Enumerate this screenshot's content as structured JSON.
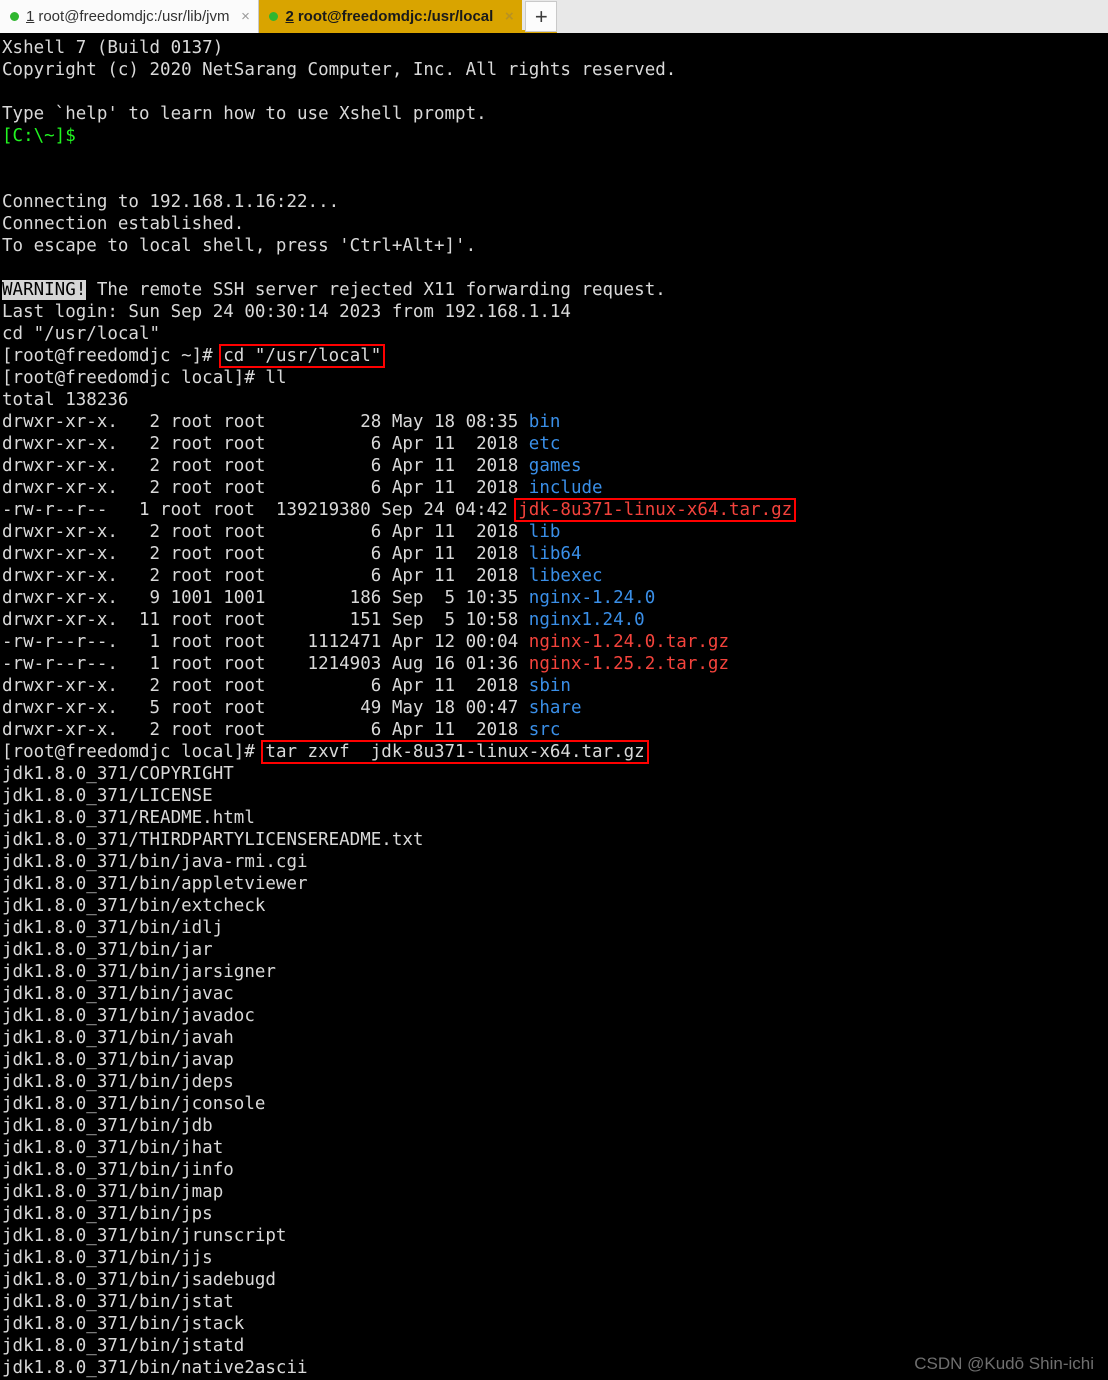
{
  "window": {
    "tabs": [
      {
        "index": "1",
        "title": "root@freedomdjc:/usr/lib/jvm",
        "close": "×",
        "active": false
      },
      {
        "index": "2",
        "title": "root@freedomdjc:/usr/local",
        "close": "×",
        "active": true
      }
    ],
    "new_tab_label": "+",
    "colors": {
      "active_tab_bg": "#d9a400",
      "inactive_tab_bg": "#fbfbfb",
      "tab_dot": "#2fb62f",
      "terminal_bg": "#000000",
      "terminal_fg": "#d6d6d6",
      "prompt_green": "#21f521",
      "dir_blue": "#3a8fe8",
      "archive_red": "#f4433c",
      "annotation_red": "#ff0000"
    }
  },
  "terminal": {
    "banner": {
      "product": "Xshell 7 (Build 0137)",
      "copyright": "Copyright (c) 2020 NetSarang Computer, Inc. All rights reserved.",
      "help_hint": "Type `help' to learn how to use Xshell prompt.",
      "local_prompt": "[C:\\~]$"
    },
    "session": {
      "connecting": "Connecting to 192.168.1.16:22...",
      "established": "Connection established.",
      "escape_hint": "To escape to local shell, press 'Ctrl+Alt+]'.",
      "warning_badge": "WARNING!",
      "warning_text": " The remote SSH server rejected X11 forwarding request.",
      "last_login": "Last login: Sun Sep 24 00:30:14 2023 from 192.168.1.14",
      "echoed_cd": "cd \"/usr/local\""
    },
    "cmd_cd": {
      "prompt": "[root@freedomdjc ~]# ",
      "command": "cd \"/usr/local\""
    },
    "cmd_ll": {
      "prompt": "[root@freedomdjc local]# ",
      "command": "ll",
      "total": "total 138236"
    },
    "listing": [
      {
        "perms": "drwxr-xr-x.",
        "links": "  2",
        "owner": "root",
        "group": "root",
        "size": "        28",
        "date": "May 18 08:35",
        "name": "bin",
        "type": "dir"
      },
      {
        "perms": "drwxr-xr-x.",
        "links": "  2",
        "owner": "root",
        "group": "root",
        "size": "         6",
        "date": "Apr 11  2018",
        "name": "etc",
        "type": "dir"
      },
      {
        "perms": "drwxr-xr-x.",
        "links": "  2",
        "owner": "root",
        "group": "root",
        "size": "         6",
        "date": "Apr 11  2018",
        "name": "games",
        "type": "dir"
      },
      {
        "perms": "drwxr-xr-x.",
        "links": "  2",
        "owner": "root",
        "group": "root",
        "size": "         6",
        "date": "Apr 11  2018",
        "name": "include",
        "type": "dir"
      },
      {
        "perms": "-rw-r--r--",
        "links": "  1",
        "owner": "root",
        "group": "root",
        "size": " 139219380",
        "date": "Sep 24 04:42",
        "name": "jdk-8u371-linux-x64.tar.gz",
        "type": "archive",
        "boxed": true
      },
      {
        "perms": "drwxr-xr-x.",
        "links": "  2",
        "owner": "root",
        "group": "root",
        "size": "         6",
        "date": "Apr 11  2018",
        "name": "lib",
        "type": "dir"
      },
      {
        "perms": "drwxr-xr-x.",
        "links": "  2",
        "owner": "root",
        "group": "root",
        "size": "         6",
        "date": "Apr 11  2018",
        "name": "lib64",
        "type": "dir"
      },
      {
        "perms": "drwxr-xr-x.",
        "links": "  2",
        "owner": "root",
        "group": "root",
        "size": "         6",
        "date": "Apr 11  2018",
        "name": "libexec",
        "type": "dir"
      },
      {
        "perms": "drwxr-xr-x.",
        "links": "  9",
        "owner": "1001",
        "group": "1001",
        "size": "       186",
        "date": "Sep  5 10:35",
        "name": "nginx-1.24.0",
        "type": "dir"
      },
      {
        "perms": "drwxr-xr-x.",
        "links": " 11",
        "owner": "root",
        "group": "root",
        "size": "       151",
        "date": "Sep  5 10:58",
        "name": "nginx1.24.0",
        "type": "dir"
      },
      {
        "perms": "-rw-r--r--.",
        "links": "  1",
        "owner": "root",
        "group": "root",
        "size": "   1112471",
        "date": "Apr 12 00:04",
        "name": "nginx-1.24.0.tar.gz",
        "type": "archive"
      },
      {
        "perms": "-rw-r--r--.",
        "links": "  1",
        "owner": "root",
        "group": "root",
        "size": "   1214903",
        "date": "Aug 16 01:36",
        "name": "nginx-1.25.2.tar.gz",
        "type": "archive"
      },
      {
        "perms": "drwxr-xr-x.",
        "links": "  2",
        "owner": "root",
        "group": "root",
        "size": "         6",
        "date": "Apr 11  2018",
        "name": "sbin",
        "type": "dir"
      },
      {
        "perms": "drwxr-xr-x.",
        "links": "  5",
        "owner": "root",
        "group": "root",
        "size": "        49",
        "date": "May 18 00:47",
        "name": "share",
        "type": "dir"
      },
      {
        "perms": "drwxr-xr-x.",
        "links": "  2",
        "owner": "root",
        "group": "root",
        "size": "         6",
        "date": "Apr 11  2018",
        "name": "src",
        "type": "dir"
      }
    ],
    "cmd_tar": {
      "prompt": "[root@freedomdjc local]# ",
      "command": "tar zxvf  jdk-8u371-linux-x64.tar.gz"
    },
    "tar_output": [
      "jdk1.8.0_371/COPYRIGHT",
      "jdk1.8.0_371/LICENSE",
      "jdk1.8.0_371/README.html",
      "jdk1.8.0_371/THIRDPARTYLICENSEREADME.txt",
      "jdk1.8.0_371/bin/java-rmi.cgi",
      "jdk1.8.0_371/bin/appletviewer",
      "jdk1.8.0_371/bin/extcheck",
      "jdk1.8.0_371/bin/idlj",
      "jdk1.8.0_371/bin/jar",
      "jdk1.8.0_371/bin/jarsigner",
      "jdk1.8.0_371/bin/javac",
      "jdk1.8.0_371/bin/javadoc",
      "jdk1.8.0_371/bin/javah",
      "jdk1.8.0_371/bin/javap",
      "jdk1.8.0_371/bin/jdeps",
      "jdk1.8.0_371/bin/jconsole",
      "jdk1.8.0_371/bin/jdb",
      "jdk1.8.0_371/bin/jhat",
      "jdk1.8.0_371/bin/jinfo",
      "jdk1.8.0_371/bin/jmap",
      "jdk1.8.0_371/bin/jps",
      "jdk1.8.0_371/bin/jrunscript",
      "jdk1.8.0_371/bin/jjs",
      "jdk1.8.0_371/bin/jsadebugd",
      "jdk1.8.0_371/bin/jstat",
      "jdk1.8.0_371/bin/jstack",
      "jdk1.8.0_371/bin/jstatd",
      "jdk1.8.0_371/bin/native2ascii"
    ]
  },
  "watermark": "CSDN @Kudō Shin-ichi"
}
